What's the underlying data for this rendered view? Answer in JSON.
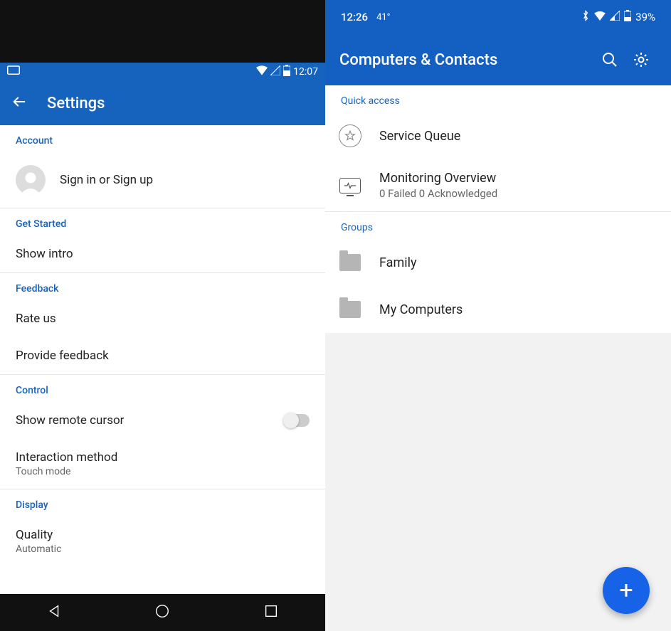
{
  "left": {
    "status": {
      "time": "12:07"
    },
    "header": {
      "title": "Settings"
    },
    "sections": {
      "account": {
        "header": "Account",
        "signin": "Sign in or Sign up"
      },
      "getstarted": {
        "header": "Get Started",
        "showintro": "Show intro"
      },
      "feedback": {
        "header": "Feedback",
        "rate": "Rate us",
        "provide": "Provide feedback"
      },
      "control": {
        "header": "Control",
        "cursor": "Show remote cursor",
        "interaction_label": "Interaction method",
        "interaction_value": "Touch mode"
      },
      "display": {
        "header": "Display",
        "quality_label": "Quality",
        "quality_value": "Automatic"
      }
    }
  },
  "right": {
    "status": {
      "time": "12:26",
      "temp": "41°",
      "battery": "39%"
    },
    "header": {
      "title": "Computers & Contacts"
    },
    "quickaccess": {
      "header": "Quick access",
      "service_queue": "Service Queue",
      "monitoring_label": "Monitoring Overview",
      "monitoring_sub": "0 Failed 0 Acknowledged"
    },
    "groups": {
      "header": "Groups",
      "family": "Family",
      "mycomputers": "My Computers"
    },
    "fab": "+"
  }
}
